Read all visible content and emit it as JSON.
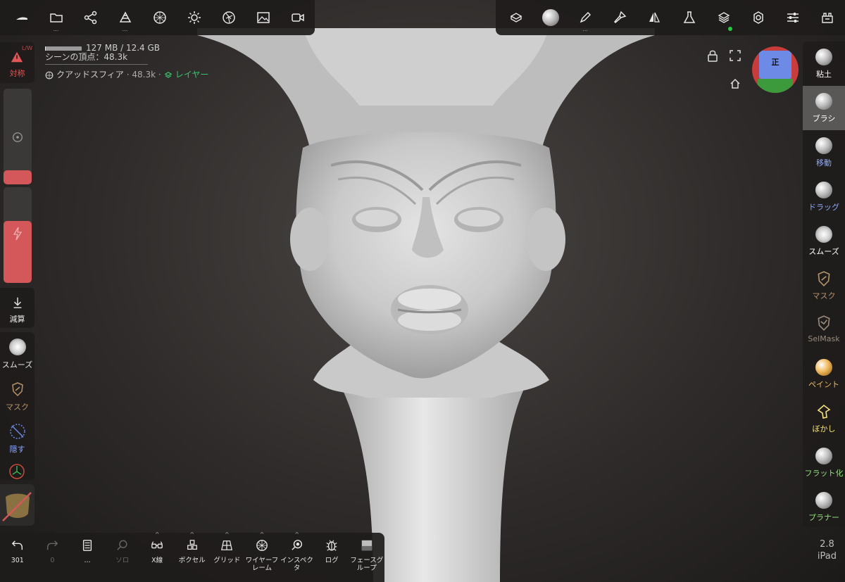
{
  "top_left_tools": [
    {
      "name": "app-logo-icon",
      "dots": ""
    },
    {
      "name": "folder-icon",
      "dots": "..."
    },
    {
      "name": "scene-graph-icon",
      "dots": ""
    },
    {
      "name": "primitives-icon",
      "dots": "..."
    },
    {
      "name": "topology-sphere-icon",
      "dots": ""
    },
    {
      "name": "light-icon",
      "dots": ""
    },
    {
      "name": "camera-shutter-icon",
      "dots": ""
    },
    {
      "name": "image-icon",
      "dots": ""
    },
    {
      "name": "video-icon",
      "dots": ""
    }
  ],
  "top_right_tools": [
    {
      "name": "material-icon",
      "dots": ""
    },
    {
      "name": "brush-sphere-icon",
      "dots": ""
    },
    {
      "name": "pen-icon",
      "dots": "..."
    },
    {
      "name": "paint-brush-icon",
      "dots": ""
    },
    {
      "name": "symmetry-icon",
      "dots": ""
    },
    {
      "name": "flask-icon",
      "dots": ""
    },
    {
      "name": "layers-icon",
      "dots": ""
    },
    {
      "name": "settings-gear-icon",
      "dots": ""
    },
    {
      "name": "sliders-icon",
      "dots": ""
    },
    {
      "name": "store-icon",
      "dots": ""
    }
  ],
  "info": {
    "memory": "127 MB / 12.4 GB",
    "vertices": "シーンの頂点：48.3k",
    "object_name": "クアッドスフィア",
    "object_vertices": "· 48.3k ·",
    "layer_label": "レイヤー",
    "memory_usage": 0.01
  },
  "left": {
    "symmetry_label": "対称",
    "symmetry_sub": "L/W",
    "radius_level": 0.15,
    "intensity_level": 0.65,
    "subtract_label": "減算",
    "smooth_label": "スムーズ",
    "mask_label": "マスク",
    "hide_label": "隠す"
  },
  "right_tools": [
    {
      "label": "粘土",
      "color": "#ffffff",
      "icon": "clay-sphere-icon",
      "active": false
    },
    {
      "label": "ブラシ",
      "color": "#ffffff",
      "icon": "brush-sphere-icon",
      "active": true
    },
    {
      "label": "移動",
      "color": "#8fa8ff",
      "icon": "move-sphere-icon",
      "active": false
    },
    {
      "label": "ドラッグ",
      "color": "#8fa8ff",
      "icon": "drag-sphere-icon",
      "active": false
    },
    {
      "label": "スムーズ",
      "color": "#ffffff",
      "icon": "smooth-sphere-icon",
      "active": false
    },
    {
      "label": "マスク",
      "color": "#b5926a",
      "icon": "mask-shield-icon",
      "active": false
    },
    {
      "label": "SelMask",
      "color": "#9a8a7a",
      "icon": "selmask-shield-icon",
      "active": false
    },
    {
      "label": "ペイント",
      "color": "#f0b85a",
      "icon": "paint-sphere-icon",
      "active": false
    },
    {
      "label": "ぼかし",
      "color": "#f5e27a",
      "icon": "smudge-icon",
      "active": false
    },
    {
      "label": "フラット化",
      "color": "#8fe07a",
      "icon": "flatten-sphere-icon",
      "active": false
    },
    {
      "label": "プラナー",
      "color": "#8fe07a",
      "icon": "planar-sphere-icon",
      "active": false
    }
  ],
  "view_cube": {
    "face": "正",
    "colors": {
      "top": "#6c8ae6",
      "side": "#c93c3c",
      "bottom": "#3c9a3c"
    }
  },
  "bottom_tools": [
    {
      "name": "undo",
      "label": "301",
      "icon": "undo-icon",
      "caret": "",
      "dim": false
    },
    {
      "name": "redo",
      "label": "0",
      "icon": "redo-icon",
      "caret": "",
      "dim": true
    },
    {
      "name": "history",
      "label": "...",
      "icon": "history-icon",
      "caret": "",
      "dim": false
    },
    {
      "name": "solo",
      "label": "ソロ",
      "icon": "solo-search-icon",
      "caret": "",
      "dim": true
    },
    {
      "name": "xray",
      "label": "X線",
      "icon": "glasses-icon",
      "caret": "^",
      "dim": false
    },
    {
      "name": "voxel",
      "label": "ボクセル",
      "icon": "voxel-icon",
      "caret": "^",
      "dim": false
    },
    {
      "name": "grid",
      "label": "グリッド",
      "icon": "grid-icon",
      "caret": "^",
      "dim": false
    },
    {
      "name": "wireframe",
      "label": "ワイヤーフレーム",
      "icon": "wireframe-icon",
      "caret": "^",
      "dim": false
    },
    {
      "name": "inspector",
      "label": "インスペクタ",
      "icon": "inspector-icon",
      "caret": "^",
      "dim": false
    },
    {
      "name": "log",
      "label": "ログ",
      "icon": "bug-icon",
      "caret": "",
      "dim": false
    },
    {
      "name": "facegroup",
      "label": "フェースグループ",
      "icon": "facegroup-icon",
      "caret": "",
      "dim": false
    }
  ],
  "version": {
    "number": "2.8",
    "device": "iPad"
  }
}
